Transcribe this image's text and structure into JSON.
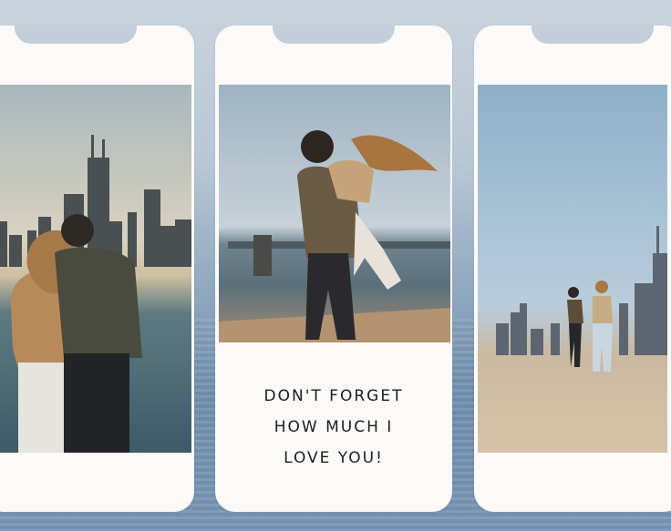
{
  "message": {
    "line1": "DON'T FORGET",
    "line2": "HOW MUCH I",
    "line3": "LOVE YOU!"
  },
  "colors": {
    "card": "#fbfaf8",
    "text": "#1d1d1d",
    "water": "#7a96b3"
  }
}
